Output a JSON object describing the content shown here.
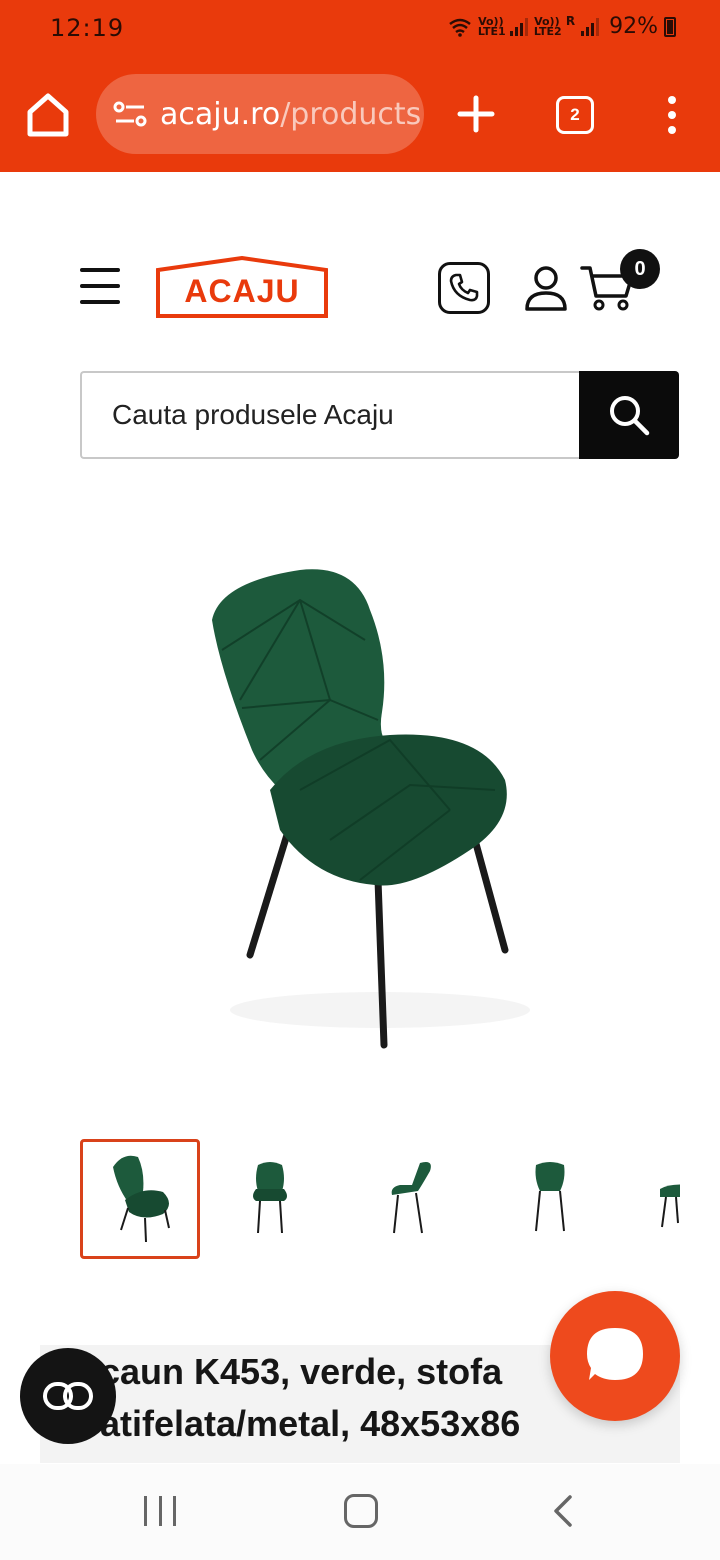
{
  "status_bar": {
    "time": "12:19",
    "sim1_label": "Vo)) LTE1",
    "sim2_label": "Vo)) LTE2",
    "roaming": "R",
    "battery": "92%"
  },
  "browser": {
    "url_host": "acaju.ro",
    "url_path": "/products",
    "tab_count": "2"
  },
  "header": {
    "logo_text": "ACAJU",
    "cart_count": "0",
    "brand_color": "#e93a0c"
  },
  "search": {
    "placeholder": "Cauta produsele Acaju"
  },
  "gallery": {
    "active_index": 0,
    "thumbnail_count_visible": 5,
    "product_color": "#1d5a3c"
  },
  "product": {
    "title": "caun K453, verde, stofa atifelata/metal, 48x53x86"
  },
  "icons": {
    "home": "home-icon",
    "site_settings": "tune-icon",
    "new_tab": "plus-icon",
    "more": "more-vertical-icon",
    "menu": "hamburger-icon",
    "phone": "phone-icon",
    "account": "user-icon",
    "cart": "cart-icon",
    "search": "search-icon",
    "chat": "chat-bubble-icon",
    "reader": "reader-mode-icon"
  }
}
